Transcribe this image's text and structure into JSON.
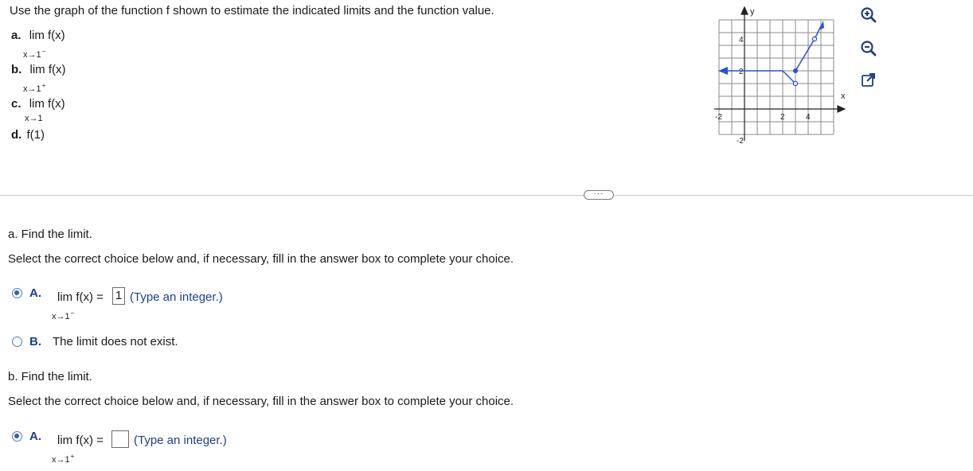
{
  "question": {
    "prompt": "Use the graph of the function f shown to estimate the indicated limits and the function value.",
    "parts": [
      {
        "letter": "a.",
        "text": "lim f(x)",
        "sub": "x→1",
        "sup": "−"
      },
      {
        "letter": "b.",
        "text": "lim f(x)",
        "sub": "x→1",
        "sup": "+"
      },
      {
        "letter": "c.",
        "text": "lim f(x)",
        "sub": "x→1",
        "sup": ""
      },
      {
        "letter": "d.",
        "text": "f(1)"
      }
    ]
  },
  "graph": {
    "axis_x_label": "x",
    "axis_y_label": "y",
    "tick_labels": {
      "x_neg2": "-2",
      "x_2": "2",
      "x_4": "4",
      "y_4": "4",
      "y_2": "2",
      "y_neg2": "-2"
    },
    "line_color": "#2a4ee0"
  },
  "tools": {
    "zoom_in": "zoom-in-icon",
    "zoom_out": "zoom-out-icon",
    "popout": "popout-icon"
  },
  "divider_button": "···",
  "part_a": {
    "heading": "a. Find the limit.",
    "instruction": "Select the correct choice below and, if necessary, fill in the answer box to complete your choice.",
    "choice_a_letter": "A.",
    "choice_a_lim": "lim f(x) =",
    "choice_a_sub": "x→1",
    "choice_a_sup": "−",
    "choice_a_value": "1",
    "choice_a_hint": "(Type an integer.)",
    "choice_b_letter": "B.",
    "choice_b_text": "The limit does not exist.",
    "selected": "A"
  },
  "part_b": {
    "heading": "b. Find the limit.",
    "instruction": "Select the correct choice below and, if necessary, fill in the answer box to complete your choice.",
    "choice_a_letter": "A.",
    "choice_a_lim": "lim f(x) =",
    "choice_a_sub": "x→1",
    "choice_a_sup": "+",
    "choice_a_value": "",
    "choice_a_hint": "(Type an integer.)",
    "selected": "A"
  }
}
